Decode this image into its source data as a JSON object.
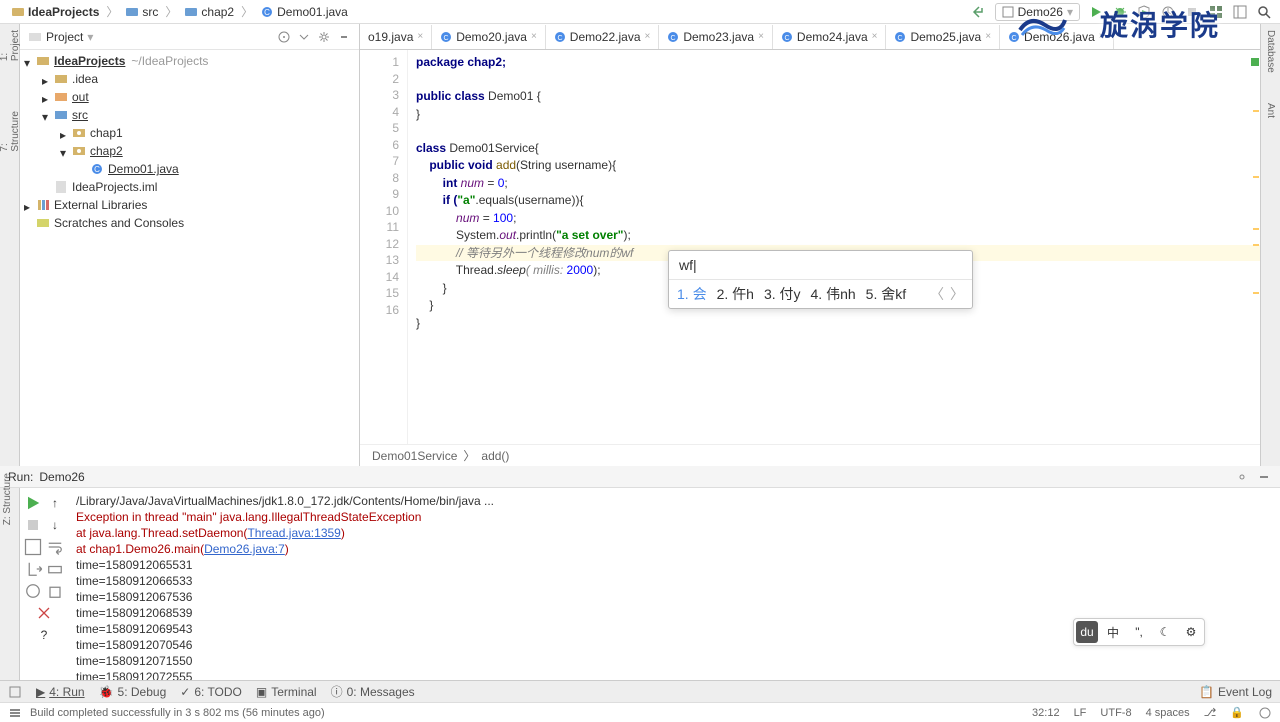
{
  "breadcrumb": [
    "IdeaProjects",
    "src",
    "chap2",
    "Demo01.java"
  ],
  "run_config": "Demo26",
  "project_panel": {
    "title": "Project",
    "root": "IdeaProjects",
    "root_path": "~/IdeaProjects",
    "nodes": {
      "idea": ".idea",
      "out": "out",
      "src": "src",
      "chap1": "chap1",
      "chap2": "chap2",
      "demo01": "Demo01.java",
      "iml": "IdeaProjects.iml",
      "ext": "External Libraries",
      "scratches": "Scratches and Consoles"
    }
  },
  "tabs": [
    "o19.java",
    "Demo20.java",
    "Demo22.java",
    "Demo23.java",
    "Demo24.java",
    "Demo25.java",
    "Demo26.java"
  ],
  "editor": {
    "lines": [
      1,
      2,
      3,
      4,
      5,
      6,
      7,
      8,
      9,
      10,
      11,
      12,
      13,
      14,
      15,
      16
    ],
    "code": {
      "l1": "package chap2;",
      "l3a": "public class ",
      "l3b": "Demo01 ",
      "l3c": "{",
      "l4": "}",
      "l6a": "class ",
      "l6b": "Demo01Service",
      "l6c": "{",
      "l7a": "    public void ",
      "l7b": "add",
      "l7c": "(String username){",
      "l8a": "        int ",
      "l8b": "num",
      "l8c": " = ",
      "l8d": "0",
      "l8e": ";",
      "l9a": "        if (",
      "l9b": "\"a\"",
      "l9c": ".equals(username)){",
      "l10a": "            ",
      "l10b": "num",
      "l10c": " = ",
      "l10d": "100",
      "l10e": ";",
      "l11a": "            System.",
      "l11b": "out",
      "l11c": ".println(",
      "l11d": "\"a set over\"",
      "l11e": ");",
      "l12a": "            ",
      "l12b": "// 等待另外一个线程修改num的wf",
      "l13a": "            Thread.",
      "l13b": "sleep",
      "l13c": "( millis: ",
      "l13d": "2000",
      "l13e": ");",
      "l14": "        }",
      "l15": "    }",
      "l16": "}"
    },
    "crumb": [
      "Demo01Service",
      "add()"
    ]
  },
  "ime": {
    "input": "wf|",
    "candidates": [
      "1. 会",
      "2. 仵h",
      "3. 付y",
      "4. 伟nh",
      "5. 舍kf"
    ]
  },
  "run": {
    "title": "Run:",
    "config": "Demo26",
    "lines": [
      "/Library/Java/JavaVirtualMachines/jdk1.8.0_172.jdk/Contents/Home/bin/java ...",
      "Exception in thread \"main\" java.lang.IllegalThreadStateException",
      "    at java.lang.Thread.setDaemon(",
      "Thread.java:1359",
      ")",
      "    at chap1.Demo26.main(",
      "Demo26.java:7",
      ")",
      "time=1580912065531",
      "time=1580912066533",
      "time=1580912067536",
      "time=1580912068539",
      "time=1580912069543",
      "time=1580912070546",
      "time=1580912071550",
      "time=1580912072555"
    ]
  },
  "bottom_bar": {
    "run": "4: Run",
    "debug": "5: Debug",
    "todo": "6: TODO",
    "terminal": "Terminal",
    "messages": "0: Messages",
    "event_log": "Event Log"
  },
  "status": {
    "msg": "Build completed successfully in 3 s 802 ms (56 minutes ago)",
    "pos": "32:12",
    "lf": "LF",
    "enc": "UTF-8",
    "indent": "4 spaces"
  },
  "logo": "旋涡学院",
  "float_toolbar": [
    "du",
    "中",
    "\",",
    "☾",
    "⚙"
  ]
}
